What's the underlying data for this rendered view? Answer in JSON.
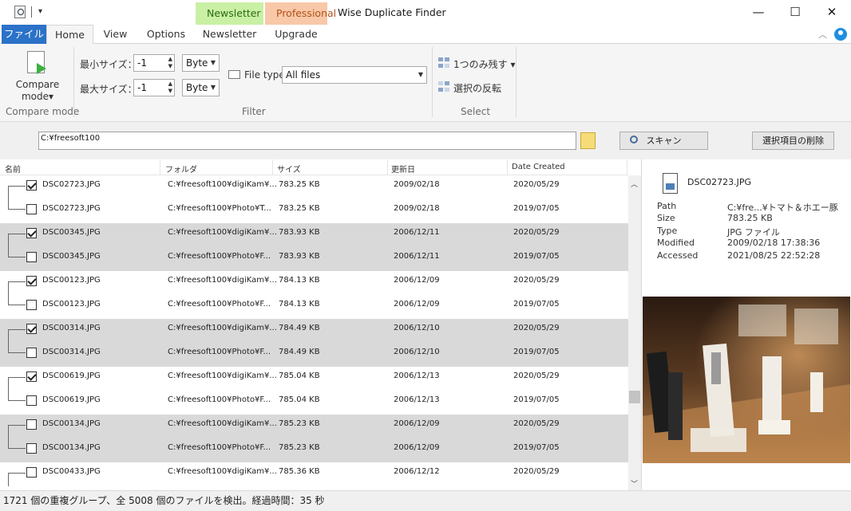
{
  "app": {
    "title": "Wise Duplicate Finder",
    "context_tab_newsletter": "Newsletter",
    "context_tab_professional": "Professional"
  },
  "window_controls": {
    "minimize": "—",
    "maximize": "☐",
    "close": "✕"
  },
  "tabs": {
    "file": "ファイル",
    "home": "Home",
    "view": "View",
    "options": "Options",
    "newsletter": "Newsletter",
    "upgrade": "Upgrade"
  },
  "ribbon": {
    "compare_mode": {
      "label_line1": "Compare",
      "label_line2": "mode▾",
      "group": "Compare mode"
    },
    "filter": {
      "min_size_label": "最小サイズ：",
      "max_size_label": "最大サイズ：",
      "min_size_value": "-1",
      "max_size_value": "-1",
      "min_unit": "Byte",
      "max_unit": "Byte",
      "file_type_label": "File type",
      "file_type_value": "All files",
      "group": "Filter"
    },
    "select": {
      "keep_one": "1つのみ残す ▾",
      "invert": "選択の反転",
      "group": "Select"
    }
  },
  "pathbar": {
    "path": "C:¥freesoft100",
    "scan_button": "スキャン",
    "delete_button": "選択項目の削除"
  },
  "columns": {
    "name": "名前",
    "folder": "フォルダ",
    "size": "サイズ",
    "modified": "更新日",
    "created": "Date Created"
  },
  "rows": [
    {
      "checked": true,
      "name": "DSC02723.JPG",
      "folder": "C:¥freesoft100¥digiKam¥...",
      "size": "783.25 KB",
      "modified": "2009/02/18",
      "created": "2020/05/29"
    },
    {
      "checked": false,
      "name": "DSC02723.JPG",
      "folder": "C:¥freesoft100¥Photo¥T...",
      "size": "783.25 KB",
      "modified": "2009/02/18",
      "created": "2019/07/05"
    },
    {
      "checked": true,
      "name": "DSC00345.JPG",
      "folder": "C:¥freesoft100¥digiKam¥...",
      "size": "783.93 KB",
      "modified": "2006/12/11",
      "created": "2020/05/29"
    },
    {
      "checked": false,
      "name": "DSC00345.JPG",
      "folder": "C:¥freesoft100¥Photo¥F...",
      "size": "783.93 KB",
      "modified": "2006/12/11",
      "created": "2019/07/05"
    },
    {
      "checked": true,
      "name": "DSC00123.JPG",
      "folder": "C:¥freesoft100¥digiKam¥...",
      "size": "784.13 KB",
      "modified": "2006/12/09",
      "created": "2020/05/29"
    },
    {
      "checked": false,
      "name": "DSC00123.JPG",
      "folder": "C:¥freesoft100¥Photo¥F...",
      "size": "784.13 KB",
      "modified": "2006/12/09",
      "created": "2019/07/05"
    },
    {
      "checked": true,
      "name": "DSC00314.JPG",
      "folder": "C:¥freesoft100¥digiKam¥...",
      "size": "784.49 KB",
      "modified": "2006/12/10",
      "created": "2020/05/29"
    },
    {
      "checked": false,
      "name": "DSC00314.JPG",
      "folder": "C:¥freesoft100¥Photo¥F...",
      "size": "784.49 KB",
      "modified": "2006/12/10",
      "created": "2019/07/05"
    },
    {
      "checked": true,
      "name": "DSC00619.JPG",
      "folder": "C:¥freesoft100¥digiKam¥...",
      "size": "785.04 KB",
      "modified": "2006/12/13",
      "created": "2020/05/29"
    },
    {
      "checked": false,
      "name": "DSC00619.JPG",
      "folder": "C:¥freesoft100¥Photo¥F...",
      "size": "785.04 KB",
      "modified": "2006/12/13",
      "created": "2019/07/05"
    },
    {
      "checked": false,
      "name": "DSC00134.JPG",
      "folder": "C:¥freesoft100¥digiKam¥...",
      "size": "785.23 KB",
      "modified": "2006/12/09",
      "created": "2020/05/29"
    },
    {
      "checked": false,
      "name": "DSC00134.JPG",
      "folder": "C:¥freesoft100¥Photo¥F...",
      "size": "785.23 KB",
      "modified": "2006/12/09",
      "created": "2019/07/05"
    },
    {
      "checked": false,
      "name": "DSC00433.JPG",
      "folder": "C:¥freesoft100¥digiKam¥...",
      "size": "785.36 KB",
      "modified": "2006/12/12",
      "created": "2020/05/29"
    }
  ],
  "detail": {
    "filename": "DSC02723.JPG",
    "labels": {
      "path": "Path",
      "size": "Size",
      "type": "Type",
      "modified": "Modified",
      "accessed": "Accessed"
    },
    "values": {
      "path": "C:¥fre...¥トマト＆ホエー豚",
      "size": "783.25 KB",
      "type": "JPG ファイル",
      "modified": "2009/02/18 17:38:36",
      "accessed": "2021/08/25 22:52:28"
    }
  },
  "status": "1721 個の重複グループ、全 5008 個のファイルを検出。経過時間：35 秒"
}
